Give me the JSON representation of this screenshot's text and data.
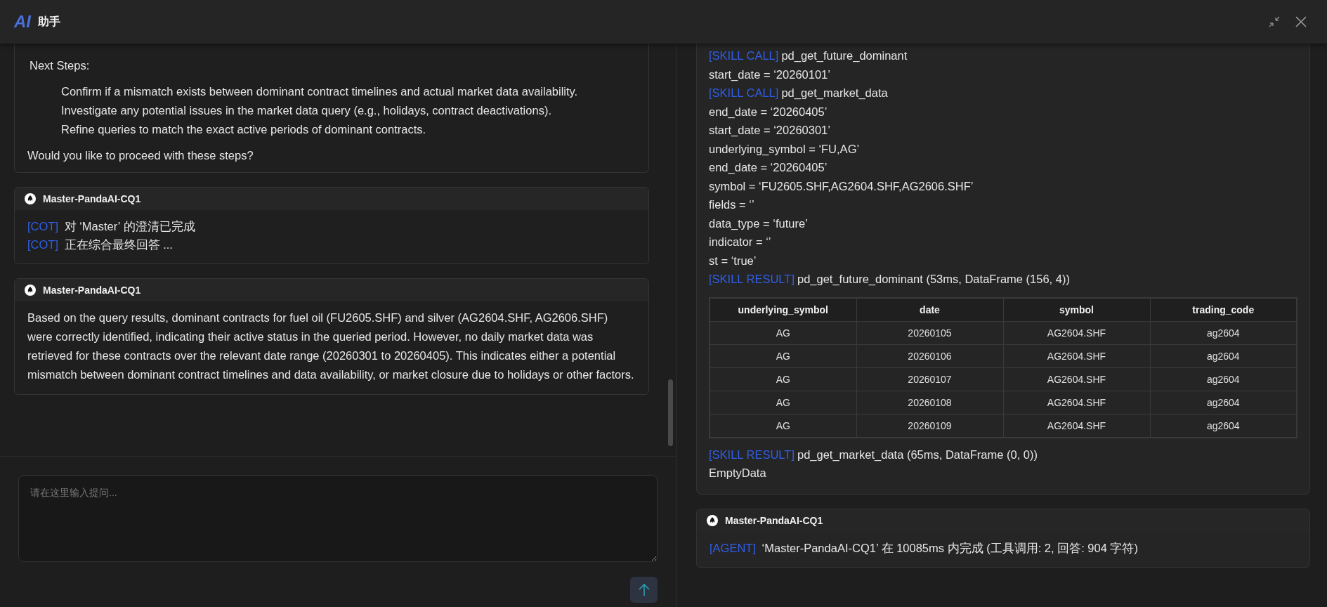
{
  "header": {
    "logo": "AI",
    "title": "助手"
  },
  "left": {
    "summary": {
      "heading": "Next Steps:",
      "steps": [
        "Confirm if a mismatch exists between dominant contract timelines and actual market data availability.",
        "Investigate any potential issues in the market data query (e.g., holidays, contract deactivations).",
        "Refine queries to match the exact active periods of dominant contracts."
      ],
      "question": "Would you like to proceed with these steps?"
    },
    "messages": [
      {
        "agent": "Master-PandaAI-CQ1",
        "lines": [
          {
            "tag": "[COT]",
            "text": "对 ‘Master’ 的澄清已完成"
          },
          {
            "tag": "[COT]",
            "text": "正在综合最终回答 ..."
          }
        ]
      },
      {
        "agent": "Master-PandaAI-CQ1",
        "paragraph": "Based on the query results, dominant contracts for fuel oil (FU2605.SHF) and silver (AG2604.SHF, AG2606.SHF) were correctly identified, indicating their active status in the queried period. However, no daily market data was retrieved for these contracts over the relevant date range (20260301 to 20260405). This indicates either a potential mismatch between dominant contract timelines and data availability, or market closure due to holidays or other factors."
      }
    ],
    "input": {
      "placeholder": "请在这里输入提问..."
    }
  },
  "right": {
    "log": [
      {
        "kind": "line",
        "tag": "[SKILL CALL]",
        "text": "pd_get_future_dominant"
      },
      {
        "kind": "line",
        "text": "start_date = ‘20260101’"
      },
      {
        "kind": "line",
        "tag": "[SKILL CALL]",
        "text": "pd_get_market_data"
      },
      {
        "kind": "line",
        "text": "end_date = ‘20260405’"
      },
      {
        "kind": "line",
        "text": "start_date = ‘20260301’"
      },
      {
        "kind": "line",
        "text": "underlying_symbol = ‘FU,AG’"
      },
      {
        "kind": "line",
        "text": "end_date = ‘20260405’"
      },
      {
        "kind": "line",
        "text": "symbol = ‘FU2605.SHF,AG2604.SHF,AG2606.SHF’"
      },
      {
        "kind": "line",
        "text": "fields = ‘’"
      },
      {
        "kind": "line",
        "text": "data_type = ‘future’"
      },
      {
        "kind": "line",
        "text": "indicator = ‘’"
      },
      {
        "kind": "line",
        "text": "st = ‘true’"
      },
      {
        "kind": "line",
        "tag": "[SKILL RESULT]",
        "text": "pd_get_future_dominant (53ms, DataFrame (156, 4))"
      },
      {
        "kind": "table",
        "columns": [
          "underlying_symbol",
          "date",
          "symbol",
          "trading_code"
        ],
        "rows": [
          [
            "AG",
            "20260105",
            "AG2604.SHF",
            "ag2604"
          ],
          [
            "AG",
            "20260106",
            "AG2604.SHF",
            "ag2604"
          ],
          [
            "AG",
            "20260107",
            "AG2604.SHF",
            "ag2604"
          ],
          [
            "AG",
            "20260108",
            "AG2604.SHF",
            "ag2604"
          ],
          [
            "AG",
            "20260109",
            "AG2604.SHF",
            "ag2604"
          ]
        ]
      },
      {
        "kind": "line",
        "tag": "[SKILL RESULT]",
        "text": "pd_get_market_data (65ms, DataFrame (0, 0))"
      },
      {
        "kind": "line",
        "text": "EmptyData"
      }
    ],
    "agent_card": {
      "agent": "Master-PandaAI-CQ1",
      "tag": "[AGENT]",
      "text": "‘Master-PandaAI-CQ1’ 在 10085ms 内完成 (工具调用: 2, 回答: 904 字符)"
    }
  }
}
